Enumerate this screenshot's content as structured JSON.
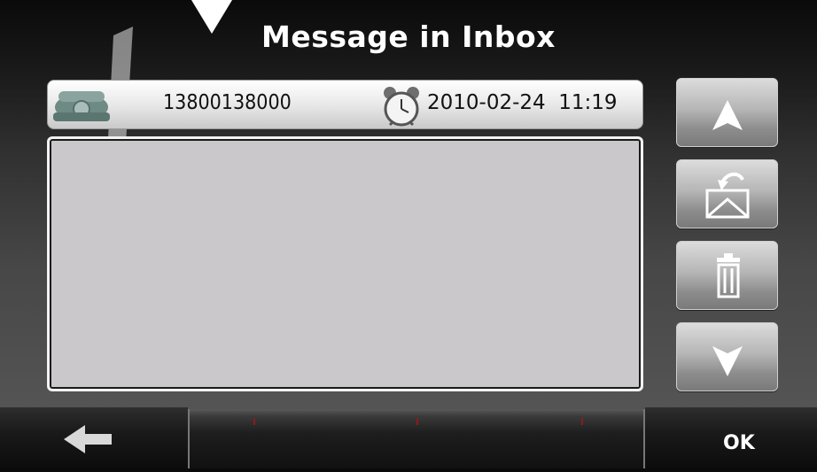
{
  "title": "Message in Inbox",
  "header": {
    "phone_number": "13800138000",
    "datetime": "2010-02-24  11:19"
  },
  "message": {
    "body": ""
  },
  "side_buttons": [
    {
      "name": "scroll-up-button",
      "icon": "arrow-up-icon"
    },
    {
      "name": "reply-button",
      "icon": "reply-envelope-icon"
    },
    {
      "name": "delete-button",
      "icon": "trash-icon"
    },
    {
      "name": "scroll-down-button",
      "icon": "arrow-down-icon"
    }
  ],
  "footer": {
    "back_icon": "back-arrow-icon",
    "ok_label": "OK"
  }
}
